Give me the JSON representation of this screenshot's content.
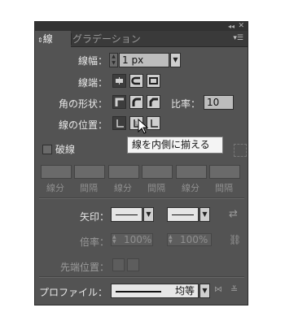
{
  "tabs": {
    "active": "線",
    "inactive": "グラデーション",
    "active_icon": "stroke-tab-icon"
  },
  "titlebar": {
    "collapse_icon": "double-chevron-icon",
    "close_icon": "close-icon",
    "menu_icon": "panel-menu-icon"
  },
  "weight": {
    "label": "線幅：",
    "value": "1 px"
  },
  "cap": {
    "label": "線端："
  },
  "corner": {
    "label": "角の形状：",
    "ratio_label": "比率：",
    "ratio_value": "10"
  },
  "align": {
    "label": "線の位置："
  },
  "tooltip": {
    "text": "線を内側に揃える"
  },
  "dashed": {
    "label": "破線",
    "columns": [
      "線分",
      "間隔",
      "線分",
      "間隔",
      "線分",
      "間隔"
    ]
  },
  "arrowheads": {
    "label": "矢印："
  },
  "scale": {
    "label": "倍率：",
    "start": "100%",
    "end": "100%"
  },
  "alignarrow": {
    "label": "先端位置："
  },
  "profile": {
    "label": "プロファイル：",
    "value": "均等"
  }
}
